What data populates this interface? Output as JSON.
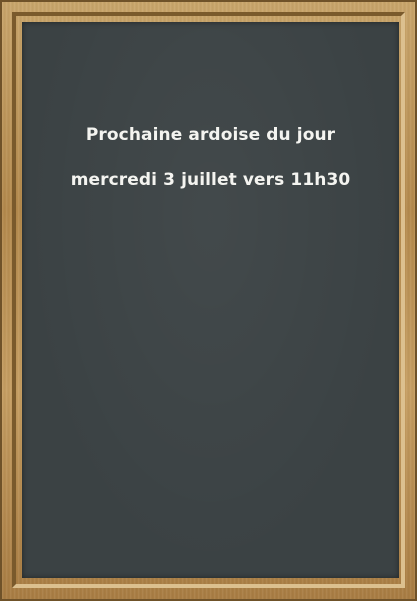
{
  "chalkboard": {
    "heading": "Prochaine ardoise du jour",
    "date_line": "mercredi 3 juillet vers 11h30"
  },
  "colors": {
    "board": "#3b4244",
    "chalk": "#f4f4f0",
    "frame_wood": "#b48a4d"
  }
}
